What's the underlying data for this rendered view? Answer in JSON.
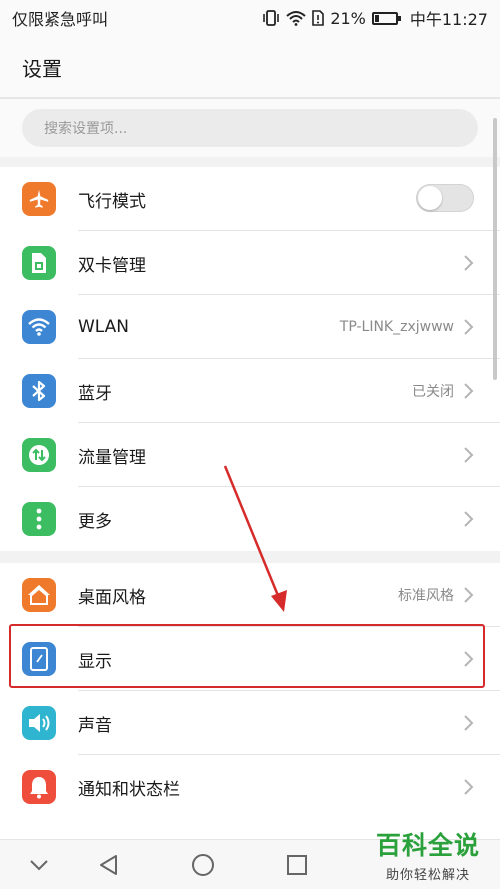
{
  "status_bar": {
    "carrier": "仅限紧急呼叫",
    "battery_percent": "21%",
    "battery_level": 0.21,
    "time": "中午11:27"
  },
  "header": {
    "title": "设置"
  },
  "search": {
    "placeholder": "搜索设置项..."
  },
  "sections": [
    {
      "items": [
        {
          "label": "飞行模式",
          "icon": "airplane-icon",
          "color": "#f07a2c",
          "type": "toggle",
          "on": false
        },
        {
          "label": "双卡管理",
          "icon": "sim-card-icon",
          "color": "#3cbd62",
          "type": "chevron"
        },
        {
          "label": "WLAN",
          "icon": "wifi-icon",
          "color": "#3d86d4",
          "value": "TP-LINK_zxjwww",
          "type": "chevron"
        },
        {
          "label": "蓝牙",
          "icon": "bluetooth-icon",
          "color": "#3d86d4",
          "value": "已关闭",
          "type": "chevron"
        },
        {
          "label": "流量管理",
          "icon": "data-usage-icon",
          "color": "#3cbd62",
          "type": "chevron"
        },
        {
          "label": "更多",
          "icon": "more-icon",
          "color": "#3cbd62",
          "type": "chevron"
        }
      ]
    },
    {
      "items": [
        {
          "label": "桌面风格",
          "icon": "home-style-icon",
          "color": "#f07a2c",
          "value": "标准风格",
          "type": "chevron"
        },
        {
          "label": "显示",
          "icon": "display-icon",
          "color": "#3d86d4",
          "type": "chevron"
        },
        {
          "label": "声音",
          "icon": "sound-icon",
          "color": "#2fb5cf",
          "type": "chevron"
        },
        {
          "label": "通知和状态栏",
          "icon": "notification-bell-icon",
          "color": "#ef4e3c",
          "type": "chevron"
        }
      ]
    }
  ],
  "nav_bar": {
    "buttons": [
      "collapse-icon",
      "back-icon",
      "home-icon",
      "recents-icon"
    ]
  },
  "watermark": {
    "title": "百科全说",
    "subtitle": "助你轻松解决"
  },
  "colors": {
    "highlight": "#d62b2b",
    "watermark_green": "#2aa13a"
  }
}
